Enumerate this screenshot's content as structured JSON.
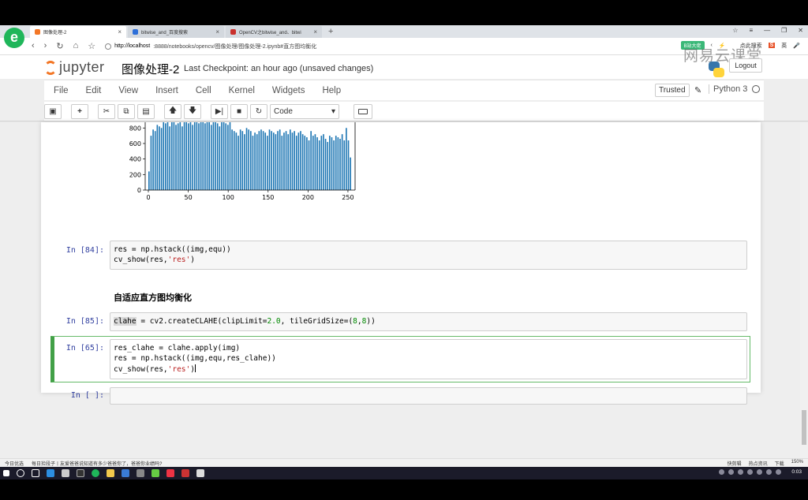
{
  "browser": {
    "tabs": [
      {
        "label": "图像处理-2",
        "active": true,
        "fav_color": "#f37726"
      },
      {
        "label": "bitwise_and_百度搜索",
        "active": false,
        "fav_color": "#2d6fd9"
      },
      {
        "label": "OpenCV之bitwise_and、bitwi",
        "active": false,
        "fav_color": "#c9302c"
      }
    ],
    "new_tab": "+",
    "url_host": "http://localhost",
    "url_rest": ":8888/notebooks/opencv/图像处理/图像处理-2.ipynb#直方图均衡化",
    "right_pill": "B站大佬",
    "search_label": "点此搜索",
    "ime_label": "英"
  },
  "jupyter": {
    "logo_text": "jupyter",
    "notebook_name": "图像处理-2",
    "checkpoint": "Last Checkpoint: an hour ago (unsaved changes)",
    "logout": "Logout",
    "watermark": "网易云课堂",
    "menu": [
      "File",
      "Edit",
      "View",
      "Insert",
      "Cell",
      "Kernel",
      "Widgets",
      "Help"
    ],
    "trusted": "Trusted",
    "kernel_name": "Python 3",
    "cell_type": "Code"
  },
  "chart_data": {
    "type": "bar",
    "title": "",
    "xlabel": "",
    "ylabel": "",
    "xlim": [
      0,
      255
    ],
    "ylim": [
      0,
      900
    ],
    "x_ticks": [
      0,
      50,
      100,
      150,
      200,
      250
    ],
    "y_ticks": [
      0,
      200,
      400,
      600,
      800
    ],
    "color": "#1f77b4",
    "values": [
      240,
      700,
      780,
      760,
      840,
      820,
      800,
      900,
      860,
      880,
      820,
      900,
      880,
      840,
      860,
      900,
      820,
      900,
      880,
      860,
      900,
      840,
      880,
      900,
      860,
      880,
      900,
      860,
      900,
      880,
      840,
      900,
      880,
      860,
      820,
      880,
      900,
      860,
      840,
      880,
      780,
      760,
      740,
      700,
      780,
      760,
      720,
      800,
      780,
      760,
      700,
      740,
      720,
      760,
      780,
      760,
      740,
      700,
      780,
      760,
      740,
      720,
      760,
      780,
      700,
      740,
      760,
      720,
      780,
      740,
      760,
      700,
      740,
      760,
      720,
      700,
      680,
      640,
      760,
      700,
      720,
      680,
      640,
      700,
      720,
      660,
      620,
      700,
      680,
      640,
      700,
      680,
      660,
      720,
      640,
      800,
      640,
      420
    ]
  },
  "cells": [
    {
      "prompt": "In [84]:",
      "lines": [
        "res = np.hstack((img,equ))",
        "cv_show(res,'res')"
      ]
    },
    {
      "markdown": "自适应直方图均衡化"
    },
    {
      "prompt": "In [85]:",
      "lines": [
        "clahe = cv2.createCLAHE(clipLimit=2.0, tileGridSize=(8,8))"
      ]
    },
    {
      "prompt": "In [65]:",
      "lines": [
        "res_clahe = clahe.apply(img)",
        "res = np.hstack((img,equ,res_clahe))",
        "cv_show(res,'res')"
      ]
    },
    {
      "prompt": "In [ ]:",
      "lines": [
        ""
      ]
    }
  ],
  "status_bar": {
    "left": "今日优选",
    "news": "每日捡段子丨友爱爸爸说知道有多少爸爸你了，爸爸你业绩吗?",
    "right_items": [
      "快剪辑",
      "热点资讯",
      "下载"
    ],
    "zoom": "150%"
  },
  "taskbar": {
    "clock": "0:03"
  }
}
